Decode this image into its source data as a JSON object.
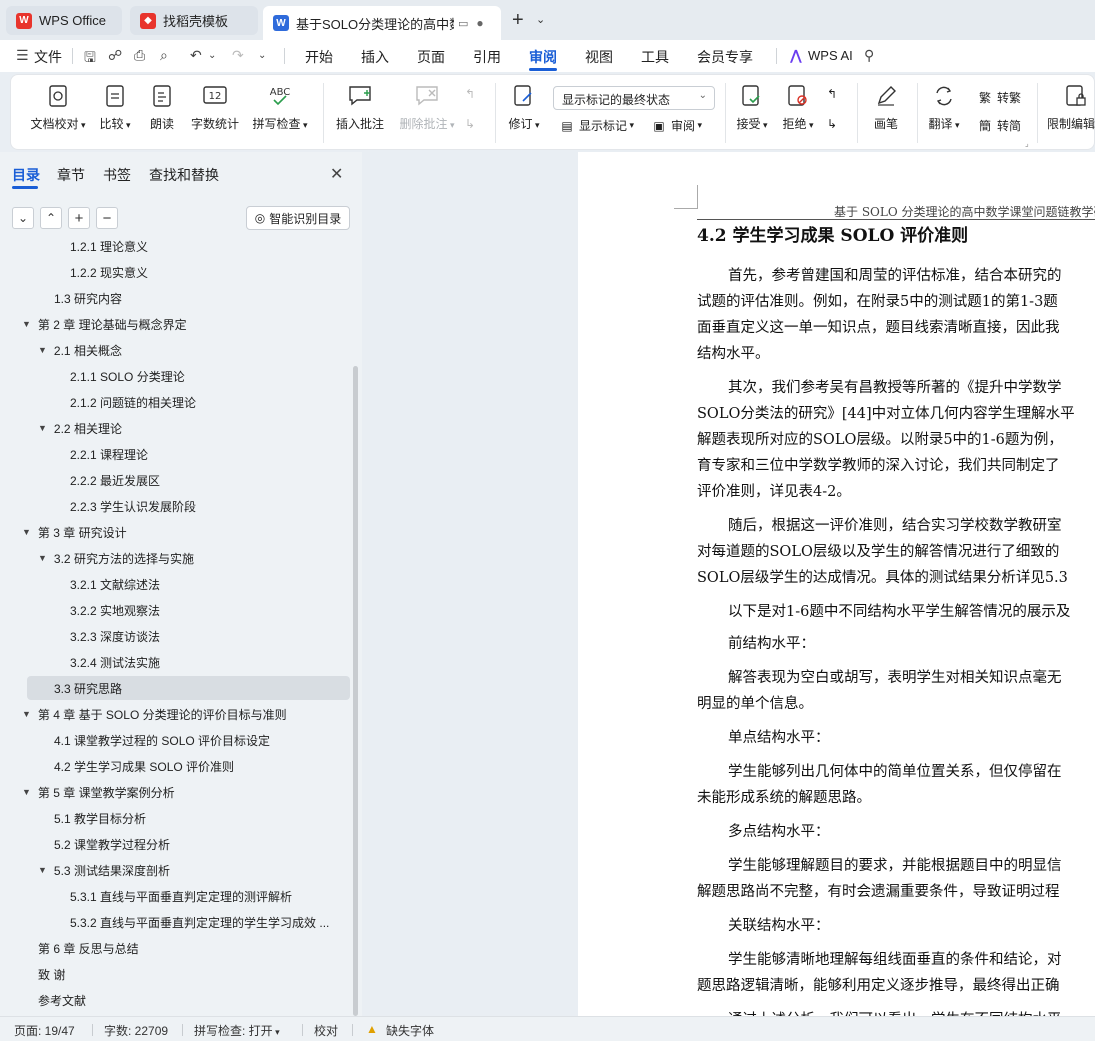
{
  "tabs": [
    {
      "label": "WPS Office"
    },
    {
      "label": "找稻壳模板"
    },
    {
      "label": "基于SOLO分类理论的高中数学"
    }
  ],
  "menu": {
    "file": "文件",
    "items": [
      "开始",
      "插入",
      "页面",
      "引用",
      "审阅",
      "视图",
      "工具",
      "会员专享"
    ],
    "active": "审阅",
    "wps_ai": "WPS AI"
  },
  "ribbon": {
    "doc_check": "文档校对",
    "compare": "比较",
    "read_aloud": "朗读",
    "word_count": "字数统计",
    "spell_check": "拼写检查",
    "insert_comment": "插入批注",
    "delete_comment": "删除批注",
    "revise": "修订",
    "display_mode": "显示标记的最终状态",
    "show_markup": "显示标记",
    "review": "审阅",
    "accept": "接受",
    "reject": "拒绝",
    "pen": "画笔",
    "translate": "翻译",
    "to_traditional": "转繁",
    "to_simplified": "转简",
    "restrict_edit": "限制编辑"
  },
  "nav": {
    "tabs": [
      "目录",
      "章节",
      "书签",
      "查找和替换"
    ],
    "active_tab": "目录",
    "smart_toc": "智能识别目录",
    "toc": [
      {
        "label": "1.2.1  理论意义",
        "level": 3,
        "caret": false
      },
      {
        "label": "1.2.2  现实意义",
        "level": 3,
        "caret": false
      },
      {
        "label": "1.3  研究内容",
        "level": 2,
        "caret": false
      },
      {
        "label": "第 2 章  理论基础与概念界定",
        "level": 1,
        "caret": true
      },
      {
        "label": "2.1  相关概念",
        "level": 2,
        "caret": true
      },
      {
        "label": "2.1.1 SOLO 分类理论",
        "level": 3,
        "caret": false
      },
      {
        "label": "2.1.2  问题链的相关理论",
        "level": 3,
        "caret": false
      },
      {
        "label": "2.2  相关理论",
        "level": 2,
        "caret": true
      },
      {
        "label": "2.2.1  课程理论",
        "level": 3,
        "caret": false
      },
      {
        "label": "2.2.2  最近发展区",
        "level": 3,
        "caret": false
      },
      {
        "label": "2.2.3  学生认识发展阶段",
        "level": 3,
        "caret": false
      },
      {
        "label": "第 3 章  研究设计",
        "level": 1,
        "caret": true
      },
      {
        "label": "3.2  研究方法的选择与实施",
        "level": 2,
        "caret": true
      },
      {
        "label": "3.2.1  文献综述法",
        "level": 3,
        "caret": false
      },
      {
        "label": "3.2.2  实地观察法",
        "level": 3,
        "caret": false
      },
      {
        "label": "3.2.3  深度访谈法",
        "level": 3,
        "caret": false
      },
      {
        "label": "3.2.4  测试法实施",
        "level": 3,
        "caret": false
      },
      {
        "label": "3.3  研究思路",
        "level": 2,
        "caret": false,
        "selected": true
      },
      {
        "label": "第 4 章  基于 SOLO 分类理论的评价目标与准则",
        "level": 1,
        "caret": true
      },
      {
        "label": "4.1  课堂教学过程的 SOLO 评价目标设定",
        "level": 2,
        "caret": false
      },
      {
        "label": "4.2  学生学习成果 SOLO 评价准则",
        "level": 2,
        "caret": false
      },
      {
        "label": "第 5 章  课堂教学案例分析",
        "level": 1,
        "caret": true
      },
      {
        "label": "5.1  教学目标分析",
        "level": 2,
        "caret": false
      },
      {
        "label": "5.2  课堂教学过程分析",
        "level": 2,
        "caret": false
      },
      {
        "label": "5.3  测试结果深度剖析",
        "level": 2,
        "caret": true
      },
      {
        "label": "5.3.1  直线与平面垂直判定定理的测评解析",
        "level": 3,
        "caret": false
      },
      {
        "label": "5.3.2  直线与平面垂直判定定理的学生学习成效 ...",
        "level": 3,
        "caret": false
      },
      {
        "label": "第 6 章  反思与总结",
        "level": 1,
        "caret": false
      },
      {
        "label": "致   谢",
        "level": 1,
        "caret": false
      },
      {
        "label": "参考文献",
        "level": 1,
        "caret": false
      }
    ]
  },
  "document": {
    "header": "基于 SOLO 分类理论的高中数学课堂问题链教学研",
    "heading": "4.2  学生学习成果 SOLO 评价准则",
    "lines": [
      "首先，参考曾建国和周莹的评估标准，结合本研究的",
      "试题的评估准则。例如，在附录5中的测试题1的第1-3题",
      "面垂直定义这一单一知识点，题目线索清晰直接，因此我",
      "结构水平。",
      "其次，我们参考吴有昌教授等所著的《提升中学数学",
      "SOLO分类法的研究》[44]中对立体几何内容学生理解水平",
      "解题表现所对应的SOLO层级。以附录5中的1-6题为例，",
      "育专家和三位中学数学教师的深入讨论，我们共同制定了",
      "评价准则，详见表4-2。",
      "随后，根据这一评价准则，结合实习学校数学教研室",
      "对每道题的SOLO层级以及学生的解答情况进行了细致的",
      "SOLO层级学生的达成情况。具体的测试结果分析详见5.3",
      "以下是对1-6题中不同结构水平学生解答情况的展示及",
      "前结构水平：",
      "解答表现为空白或胡写，表明学生对相关知识点毫无",
      "明显的单个信息。",
      "单点结构水平：",
      "学生能够列出几何体中的简单位置关系，但仅停留在",
      "未能形成系统的解题思路。",
      "多点结构水平：",
      "学生能够理解题目的要求，并能根据题目中的明显信",
      "解题思路尚不完整，有时会遗漏重要条件，导致证明过程",
      "关联结构水平：",
      "学生能够清晰地理解每组线面垂直的条件和结论，对",
      "题思路逻辑清晰，能够利用定义逐步推导，最终得出正确",
      "通过上述分析，我们可以看出，学生在不同结构水平"
    ]
  },
  "status": {
    "page": "页面: 19/47",
    "words": "字数: 22709",
    "spell": "拼写检查: 打开",
    "proof": "校对",
    "missing_font": "缺失字体"
  }
}
